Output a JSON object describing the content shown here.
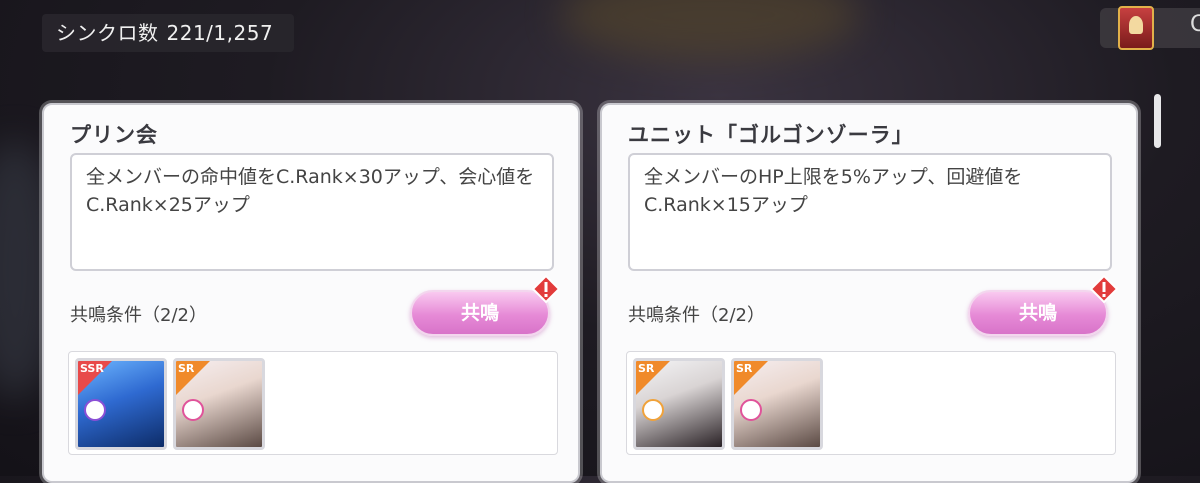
{
  "hud": {
    "sync_label": "シンクロ数",
    "sync_value": "221/1,257"
  },
  "cards": [
    {
      "title": "プリン会",
      "description": "全メンバーの命中値をC.Rank×30アップ、会心値をC.Rank×25アップ",
      "condition": "共鳴条件（2/2）",
      "button_label": "共鳴",
      "members": [
        {
          "rarity": "SSR",
          "attr_color": "#8a4fd6"
        },
        {
          "rarity": "SR",
          "attr_color": "#e0539a"
        }
      ]
    },
    {
      "title": "ユニット「ゴルゴンゾーラ」",
      "description": "全メンバーのHP上限を5%アップ、回避値をC.Rank×15アップ",
      "condition": "共鳴条件（2/2）",
      "button_label": "共鳴",
      "members": [
        {
          "rarity": "SR",
          "attr_color": "#f0a23a"
        },
        {
          "rarity": "SR",
          "attr_color": "#e0539a"
        }
      ]
    }
  ],
  "colors": {
    "button_pink": "#e68ad6",
    "alert_red": "#e23b3b",
    "ssr_badge": "#e84a4a",
    "sr_badge": "#f08a2a"
  },
  "icons": [
    "trophy-icon",
    "alert-icon",
    "attribute-gem-icon"
  ]
}
